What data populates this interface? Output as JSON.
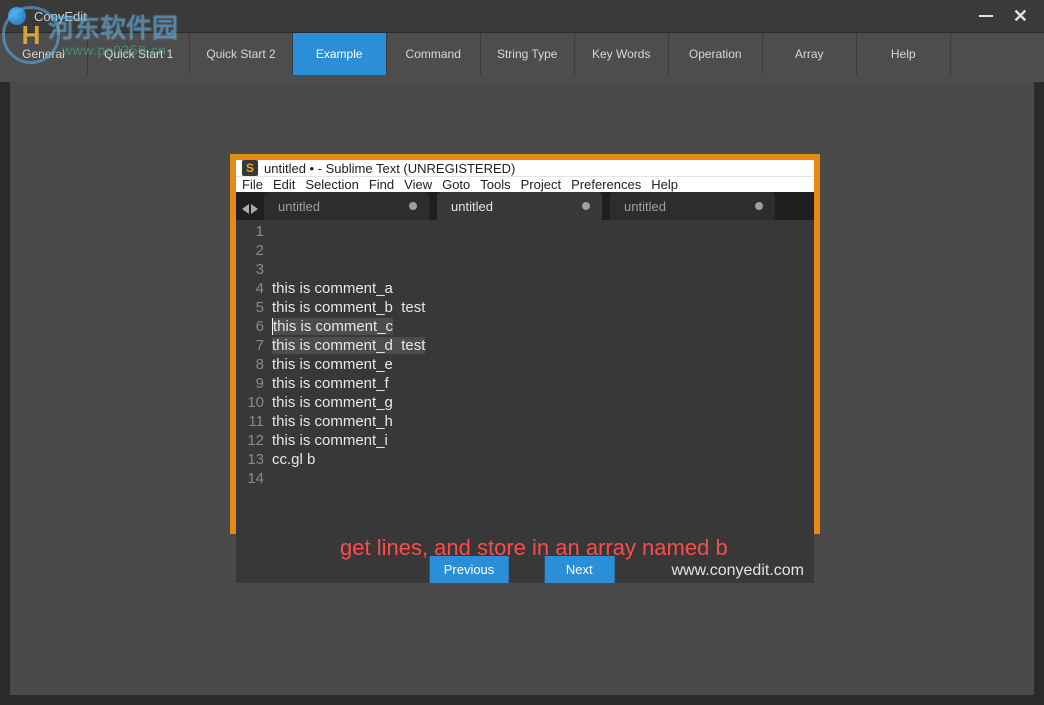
{
  "app": {
    "title": "ConyEdit"
  },
  "watermark": {
    "inner": "H",
    "text": "河东软件园",
    "url": "www.pc0359.cn"
  },
  "tabs_group1": [
    "General",
    "Quick Start 1",
    "Quick Start 2"
  ],
  "tabs_group2": [
    "Example",
    "Command",
    "String Type",
    "Key Words",
    "Operation",
    "Array",
    "Help"
  ],
  "active_tab": "Example",
  "sublime": {
    "title": "untitled • - Sublime Text (UNREGISTERED)",
    "menu": [
      "File",
      "Edit",
      "Selection",
      "Find",
      "View",
      "Goto",
      "Tools",
      "Project",
      "Preferences",
      "Help"
    ],
    "tabs": [
      {
        "label": "untitled",
        "active": false,
        "dirty": true
      },
      {
        "label": "untitled",
        "active": true,
        "dirty": true
      },
      {
        "label": "untitled",
        "active": false,
        "dirty": true
      }
    ],
    "lines": [
      {
        "n": 1,
        "text": ""
      },
      {
        "n": 2,
        "text": "this is comment_a"
      },
      {
        "n": 3,
        "text": "this is comment_b  test"
      },
      {
        "n": 4,
        "text": "this is comment_c",
        "selected": true,
        "cursor": true
      },
      {
        "n": 5,
        "text": "this is comment_d  test",
        "selected": true
      },
      {
        "n": 6,
        "text": "this is comment_e"
      },
      {
        "n": 7,
        "text": "this is comment_f"
      },
      {
        "n": 8,
        "text": "this is comment_g"
      },
      {
        "n": 9,
        "text": "this is comment_h"
      },
      {
        "n": 10,
        "text": "this is comment_i"
      },
      {
        "n": 11,
        "text": "cc.gl b"
      },
      {
        "n": 12,
        "text": ""
      },
      {
        "n": 13,
        "text": ""
      },
      {
        "n": 14,
        "text": ""
      }
    ],
    "annotation": "get lines, and store in an array named b",
    "footer_url": "www.conyedit.com"
  },
  "buttons": {
    "previous": "Previous",
    "next": "Next"
  }
}
